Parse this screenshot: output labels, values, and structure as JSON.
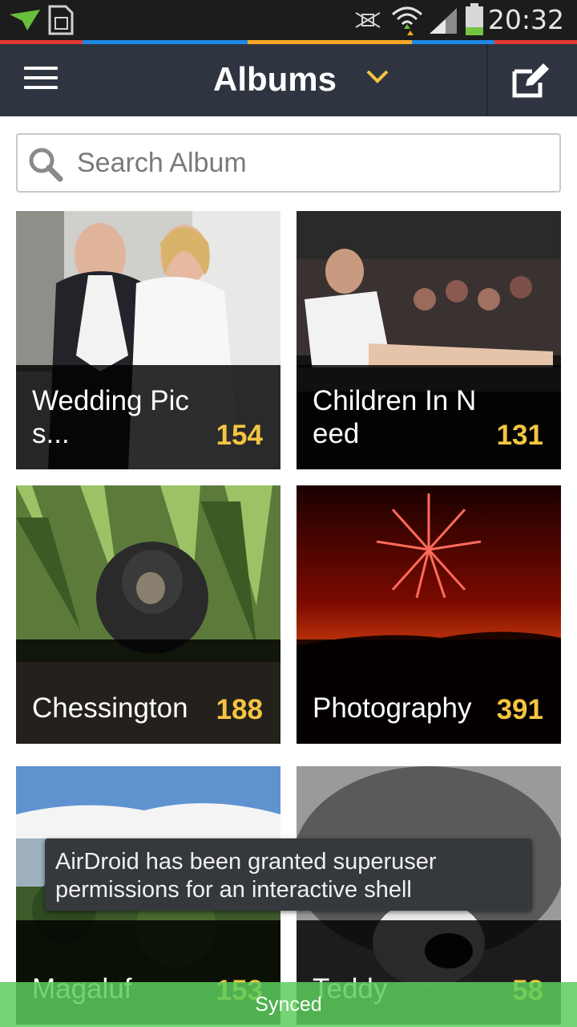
{
  "status_bar": {
    "time": "20:32",
    "icons": [
      "airdroid-notify-icon",
      "sim-card-icon",
      "silent-icon",
      "wifi-icon",
      "signal-icon",
      "battery-icon"
    ]
  },
  "color_strip": [
    "#e53935",
    "#e53935",
    "#1e88e5",
    "#1e88e5",
    "#f9a825",
    "#f9a825",
    "#43a047",
    "#1e88e5",
    "#e53935",
    "#e53935"
  ],
  "toolbar": {
    "title": "Albums",
    "accent": "#f5c542"
  },
  "search": {
    "placeholder": "Search Album"
  },
  "albums": [
    {
      "name": "Wedding Pics...",
      "count": "154"
    },
    {
      "name": "Children In Need",
      "count": "131"
    },
    {
      "name": "Chessington",
      "count": "188"
    },
    {
      "name": "Photography",
      "count": "391"
    },
    {
      "name": "Magaluf",
      "count": "153"
    },
    {
      "name": "Teddy",
      "count": "58"
    }
  ],
  "toast": {
    "text": "AirDroid has been granted superuser permissions for an interactive shell"
  },
  "sync_bar": {
    "text": "Synced"
  }
}
